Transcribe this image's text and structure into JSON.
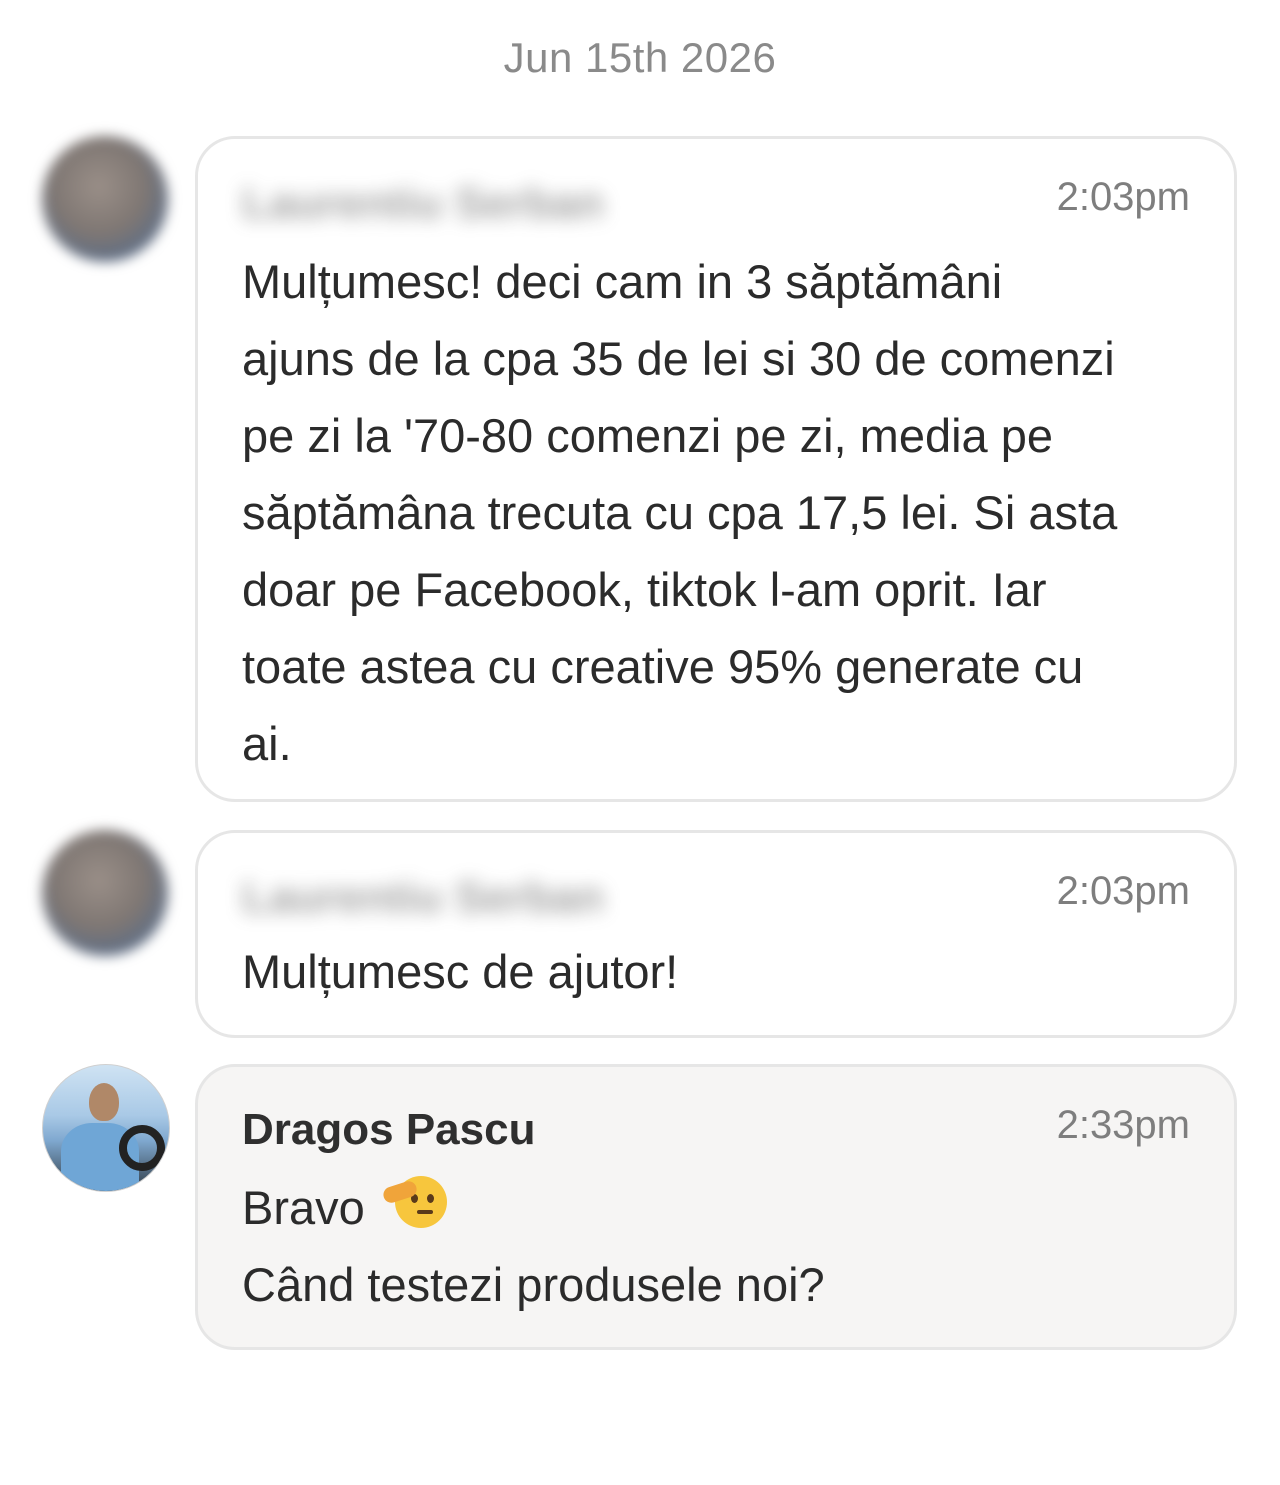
{
  "date_separator": "Jun 15th 2026",
  "messages": [
    {
      "sender": "Laurentiu Serban",
      "sender_blurred": true,
      "time": "2:03pm",
      "lines": [
        "Mulțumesc! deci cam in 3 săptămâni",
        "ajuns de la cpa 35 de lei si 30 de comenzi",
        "pe zi la '70-80 comenzi pe zi, media pe",
        "săptămâna trecuta cu cpa 17,5 lei. Si asta",
        "doar pe Facebook, tiktok l-am oprit. Iar",
        "toate astea cu creative 95% generate cu",
        "ai."
      ]
    },
    {
      "sender": "Laurentiu Serban",
      "sender_blurred": true,
      "time": "2:03pm",
      "lines": [
        "Mulțumesc de ajutor!"
      ]
    },
    {
      "sender": "Dragos Pascu",
      "sender_blurred": false,
      "time": "2:33pm",
      "lines": [
        "Bravo",
        "Când testezi produsele noi?"
      ],
      "emoji": "saluting-face-emoji"
    }
  ]
}
